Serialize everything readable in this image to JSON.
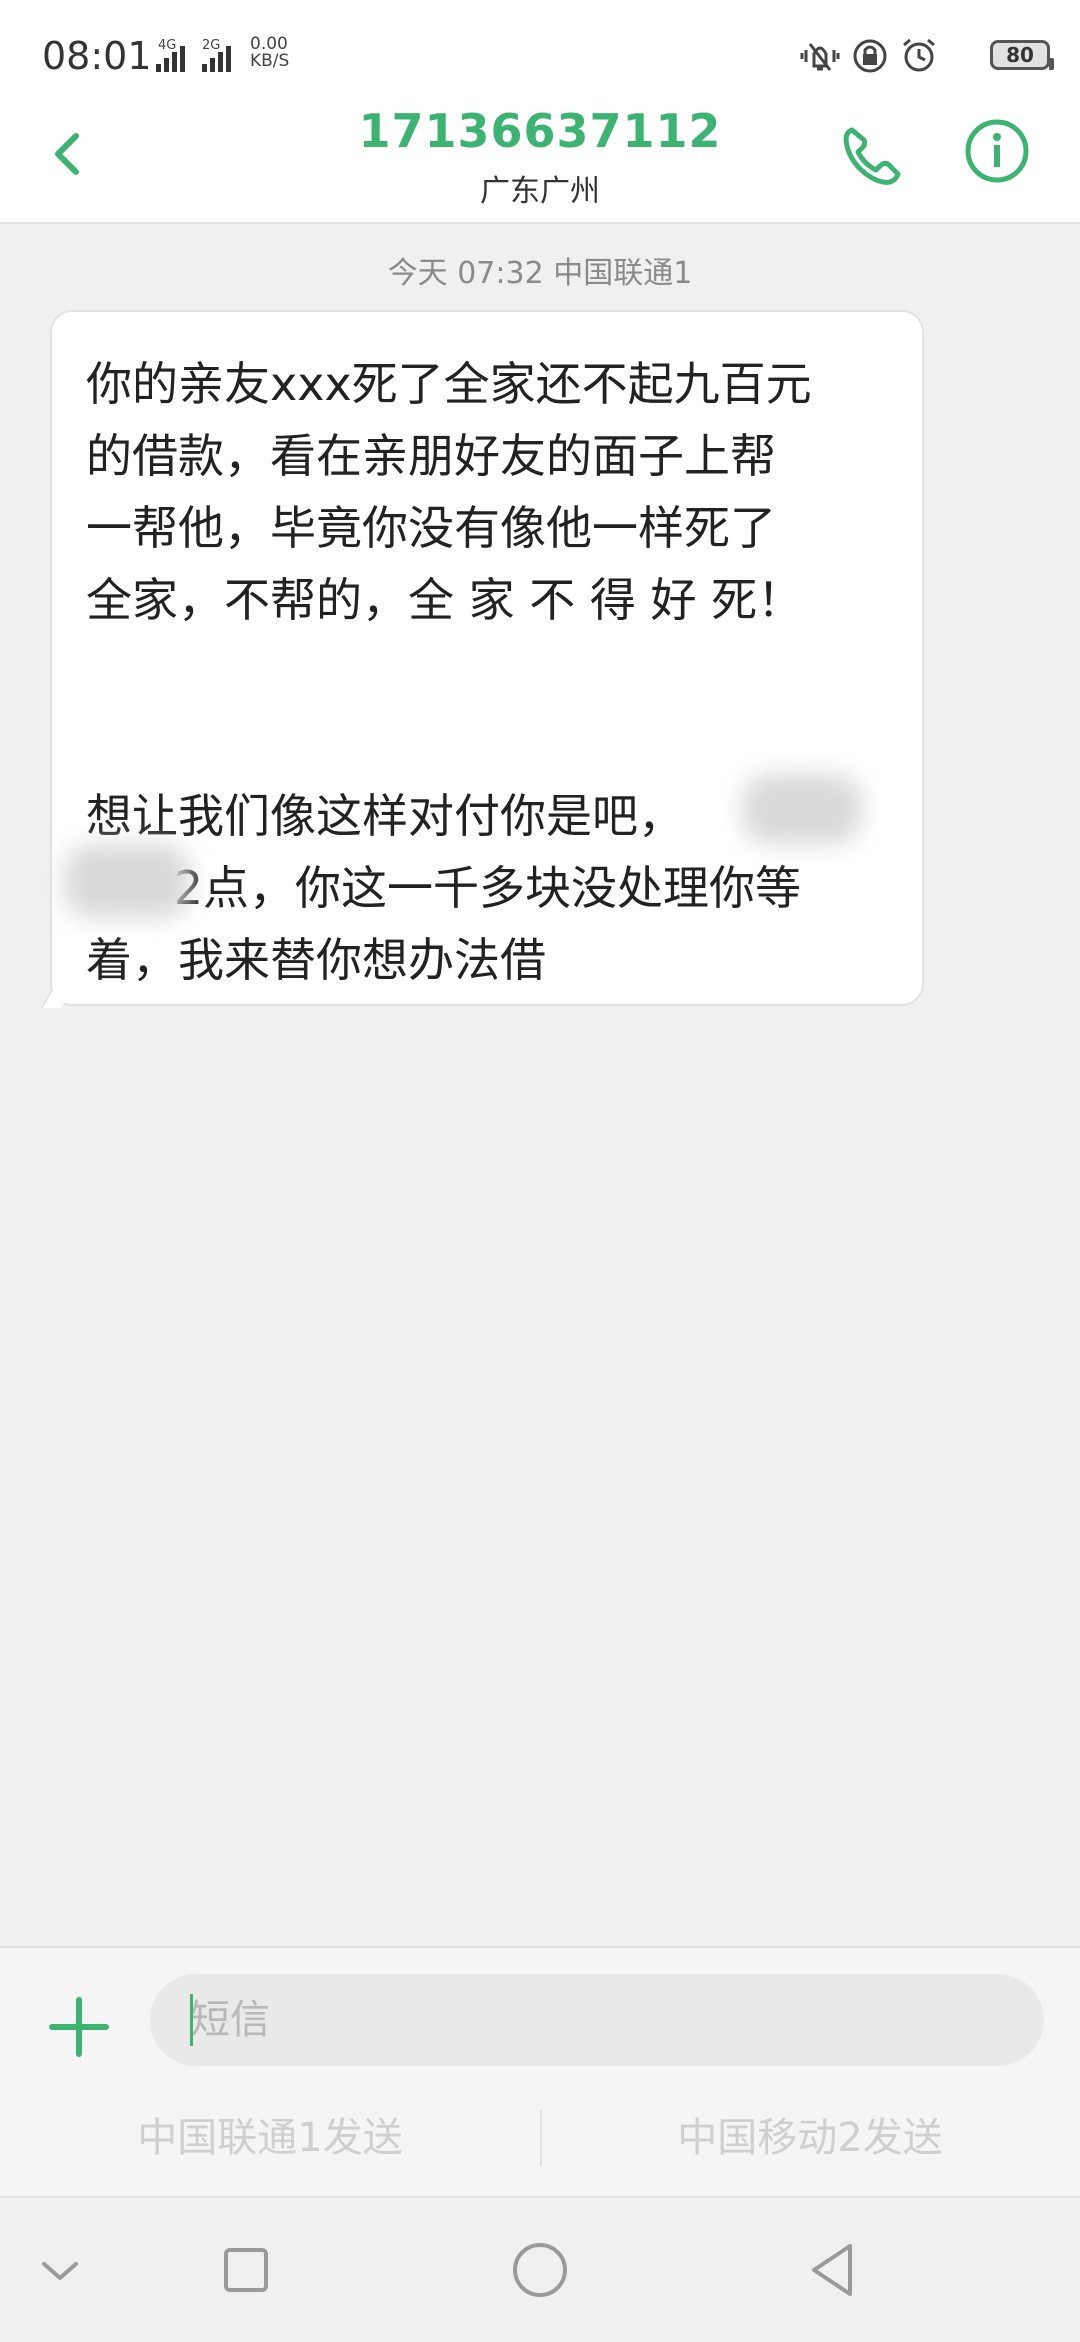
{
  "status_bar": {
    "time": "08:01",
    "sim1_label": "4G",
    "sim2_label": "2G",
    "net_speed_value": "0.00",
    "net_speed_unit": "KB/S",
    "battery_percent": "80"
  },
  "header": {
    "contact_number": "17136637112",
    "contact_location": "广东广州"
  },
  "conversation": {
    "timestamp": "今天 07:32  中国联通1",
    "message": {
      "lines_part1": [
        "你的亲友xxx死了全家还不起九百元",
        "的借款，看在亲朋好友的面子上帮",
        "一帮他，毕竟你没有像他一样死了",
        "全家，不帮的，全 家 不 得 好 死！"
      ],
      "lines_part2": [
        "想让我们像这样对付你是吧，",
        "      2点，你这一千多块没处理你等",
        "着，我来替你想办法借"
      ]
    }
  },
  "compose": {
    "placeholder": "短信",
    "send_sim1_label": "中国联通1发送",
    "send_sim2_label": "中国移动2发送"
  },
  "colors": {
    "accent": "#3cb371",
    "background": "#f0f0f0"
  }
}
